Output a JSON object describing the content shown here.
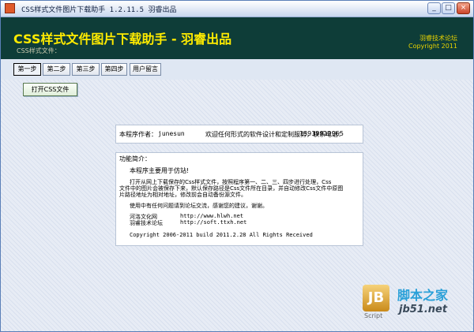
{
  "window": {
    "title": "CSS样式文件图片下载助手 1.2.11.5  羽睿出品",
    "buttons": {
      "minimize": "_",
      "maximize": "□",
      "close": "×"
    }
  },
  "banner": {
    "title": "CSS样式文件图片下载助手 - 羽睿出品",
    "subtitle": "CSS样式文件：",
    "forum": "羽睿技术论坛",
    "copyright": "Copyright 2011"
  },
  "tabs": [
    {
      "label": "第一步",
      "active": true
    },
    {
      "label": "第二步",
      "active": false
    },
    {
      "label": "第三步",
      "active": false
    },
    {
      "label": "第四步",
      "active": false
    },
    {
      "label": "用户留言",
      "active": false
    }
  ],
  "open_button": "打开CSS文件",
  "author": {
    "label": "本程序作者：",
    "name": "junesun",
    "contact": "欢迎任何形式的软件设计和定制服务，联系电话：",
    "phone": "13939912965"
  },
  "intro": {
    "heading": "功能简介：",
    "line1": "本程序主要用于仿站!",
    "para1": "打开从网上下载保存的Css样式文件，按照程序第一、二、三、四步进行处理，Css",
    "para2": "文件中的图片会被保存下来，默认保存路径是Css文件所在目录，并自动修改Css文件中原图",
    "para3": "片路径地址为相对地址，修改前会自动备份源文件。",
    "feedback": "使用中有任何问题请到论坛交流，感谢您的建议，谢谢。",
    "links": [
      {
        "name": "河洛文化网",
        "url": "http://www.hlwh.net"
      },
      {
        "name": "羽睿技术论坛",
        "url": "http://soft.ttxh.net"
      }
    ],
    "copyright": "Copyright 2006-2011  build 2011.2.28  All Rights Received"
  },
  "watermark": {
    "logo_letter": "JB",
    "script": "Script",
    "site_name": "脚本之家",
    "site_url": "jb51.net"
  }
}
